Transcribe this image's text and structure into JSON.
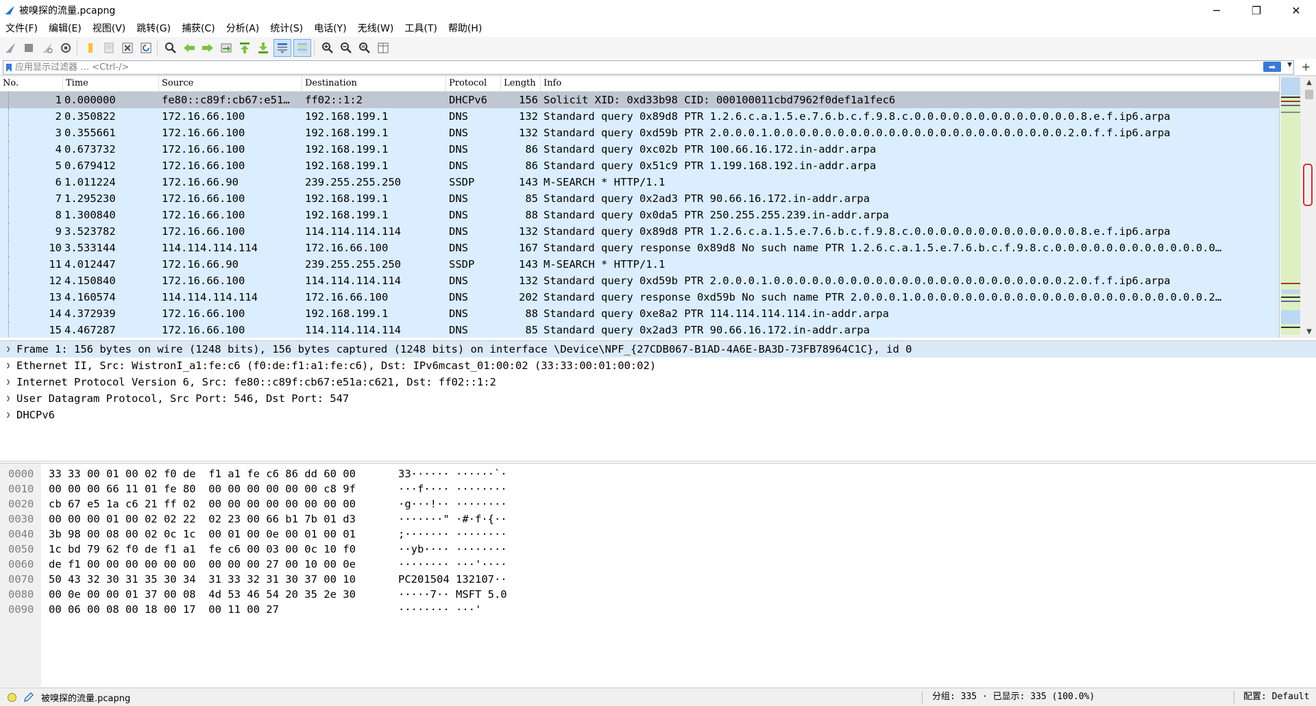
{
  "window": {
    "title": "被嗅探的流量.pcapng",
    "minimize": "─",
    "restore": "❐",
    "close": "✕"
  },
  "menu": [
    "文件(F)",
    "编辑(E)",
    "视图(V)",
    "跳转(G)",
    "捕获(C)",
    "分析(A)",
    "统计(S)",
    "电话(Y)",
    "无线(W)",
    "工具(T)",
    "帮助(H)"
  ],
  "filter": {
    "placeholder": "应用显示过滤器 … <Ctrl-/>",
    "plus": "+"
  },
  "packet_list": {
    "columns": [
      "No.",
      "Time",
      "Source",
      "Destination",
      "Protocol",
      "Length",
      "Info"
    ],
    "rows": [
      [
        "1",
        "0.000000",
        "fe80::c89f:cb67:e51…",
        "ff02::1:2",
        "DHCPv6",
        "156",
        "Solicit XID: 0xd33b98 CID: 000100011cbd7962f0def1a1fec6"
      ],
      [
        "2",
        "0.350822",
        "172.16.66.100",
        "192.168.199.1",
        "DNS",
        "132",
        "Standard query 0x89d8 PTR 1.2.6.c.a.1.5.e.7.6.b.c.f.9.8.c.0.0.0.0.0.0.0.0.0.0.0.0.0.8.e.f.ip6.arpa"
      ],
      [
        "3",
        "0.355661",
        "172.16.66.100",
        "192.168.199.1",
        "DNS",
        "132",
        "Standard query 0xd59b PTR 2.0.0.0.1.0.0.0.0.0.0.0.0.0.0.0.0.0.0.0.0.0.0.0.0.0.0.0.2.0.f.f.ip6.arpa"
      ],
      [
        "4",
        "0.673732",
        "172.16.66.100",
        "192.168.199.1",
        "DNS",
        "86",
        "Standard query 0xc02b PTR 100.66.16.172.in-addr.arpa"
      ],
      [
        "5",
        "0.679412",
        "172.16.66.100",
        "192.168.199.1",
        "DNS",
        "86",
        "Standard query 0x51c9 PTR 1.199.168.192.in-addr.arpa"
      ],
      [
        "6",
        "1.011224",
        "172.16.66.90",
        "239.255.255.250",
        "SSDP",
        "143",
        "M-SEARCH * HTTP/1.1"
      ],
      [
        "7",
        "1.295230",
        "172.16.66.100",
        "192.168.199.1",
        "DNS",
        "85",
        "Standard query 0x2ad3 PTR 90.66.16.172.in-addr.arpa"
      ],
      [
        "8",
        "1.300840",
        "172.16.66.100",
        "192.168.199.1",
        "DNS",
        "88",
        "Standard query 0x0da5 PTR 250.255.255.239.in-addr.arpa"
      ],
      [
        "9",
        "3.523782",
        "172.16.66.100",
        "114.114.114.114",
        "DNS",
        "132",
        "Standard query 0x89d8 PTR 1.2.6.c.a.1.5.e.7.6.b.c.f.9.8.c.0.0.0.0.0.0.0.0.0.0.0.0.0.8.e.f.ip6.arpa"
      ],
      [
        "10",
        "3.533144",
        "114.114.114.114",
        "172.16.66.100",
        "DNS",
        "167",
        "Standard query response 0x89d8 No such name PTR 1.2.6.c.a.1.5.e.7.6.b.c.f.9.8.c.0.0.0.0.0.0.0.0.0.0.0.0.0…"
      ],
      [
        "11",
        "4.012447",
        "172.16.66.90",
        "239.255.255.250",
        "SSDP",
        "143",
        "M-SEARCH * HTTP/1.1"
      ],
      [
        "12",
        "4.150840",
        "172.16.66.100",
        "114.114.114.114",
        "DNS",
        "132",
        "Standard query 0xd59b PTR 2.0.0.0.1.0.0.0.0.0.0.0.0.0.0.0.0.0.0.0.0.0.0.0.0.0.0.0.2.0.f.f.ip6.arpa"
      ],
      [
        "13",
        "4.160574",
        "114.114.114.114",
        "172.16.66.100",
        "DNS",
        "202",
        "Standard query response 0xd59b No such name PTR 2.0.0.0.1.0.0.0.0.0.0.0.0.0.0.0.0.0.0.0.0.0.0.0.0.0.0.0.2…"
      ],
      [
        "14",
        "4.372939",
        "172.16.66.100",
        "192.168.199.1",
        "DNS",
        "88",
        "Standard query 0xe8a2 PTR 114.114.114.114.in-addr.arpa"
      ],
      [
        "15",
        "4.467287",
        "172.16.66.100",
        "114.114.114.114",
        "DNS",
        "85",
        "Standard query 0x2ad3 PTR 90.66.16.172.in-addr.arpa"
      ]
    ],
    "selected_row": 0
  },
  "details": [
    "Frame 1: 156 bytes on wire (1248 bits), 156 bytes captured (1248 bits) on interface \\Device\\NPF_{27CDB067-B1AD-4A6E-BA3D-73FB78964C1C}, id 0",
    "Ethernet II, Src: WistronI_a1:fe:c6 (f0:de:f1:a1:fe:c6), Dst: IPv6mcast_01:00:02 (33:33:00:01:00:02)",
    "Internet Protocol Version 6, Src: fe80::c89f:cb67:e51a:c621, Dst: ff02::1:2",
    "User Datagram Protocol, Src Port: 546, Dst Port: 547",
    "DHCPv6"
  ],
  "bytes": {
    "offsets": [
      "0000",
      "0010",
      "0020",
      "0030",
      "0040",
      "0050",
      "0060",
      "0070",
      "0080",
      "0090"
    ],
    "hex": [
      "33 33 00 01 00 02 f0 de  f1 a1 fe c6 86 dd 60 00",
      "00 00 00 66 11 01 fe 80  00 00 00 00 00 00 c8 9f",
      "cb 67 e5 1a c6 21 ff 02  00 00 00 00 00 00 00 00",
      "00 00 00 01 00 02 02 22  02 23 00 66 b1 7b 01 d3",
      "3b 98 00 08 00 02 0c 1c  00 01 00 0e 00 01 00 01",
      "1c bd 79 62 f0 de f1 a1  fe c6 00 03 00 0c 10 f0",
      "de f1 00 00 00 00 00 00  00 00 00 27 00 10 00 0e",
      "50 43 32 30 31 35 30 34  31 33 32 31 30 37 00 10",
      "00 0e 00 00 01 37 00 08  4d 53 46 54 20 35 2e 30",
      "00 06 00 08 00 18 00 17  00 11 00 27"
    ],
    "ascii": [
      "33······ ······`·",
      "···f···· ········",
      "·g···!·· ········",
      "·······\" ·#·f·{··",
      ";······· ········",
      "··yb···· ········",
      "········ ···'····",
      "PC201504 132107··",
      "·····7·· MSFT 5.0",
      "········ ···'"
    ]
  },
  "status": {
    "file": "被嗅探的流量.pcapng",
    "stats": "分组: 335 · 已显示: 335 (100.0%)",
    "profile": "配置: Default"
  },
  "colors": {
    "row_bg": "#daeeff",
    "selected_row_bg": "#bfc7d3",
    "minimap_bg": "#dcf0c2",
    "apply_button": "#3a79d8"
  },
  "icons": [
    "shark-fin-icon",
    "stop-icon",
    "restart-icon",
    "options-gear-icon",
    "open-file-icon",
    "save-file-icon",
    "close-file-icon",
    "reload-icon",
    "find-icon",
    "back-arrow-icon",
    "forward-arrow-icon",
    "goto-packet-icon",
    "first-packet-icon",
    "last-packet-icon",
    "autoscroll-icon",
    "colorize-icon",
    "zoom-in-icon",
    "zoom-out-icon",
    "zoom-normal-icon",
    "resize-columns-icon"
  ]
}
